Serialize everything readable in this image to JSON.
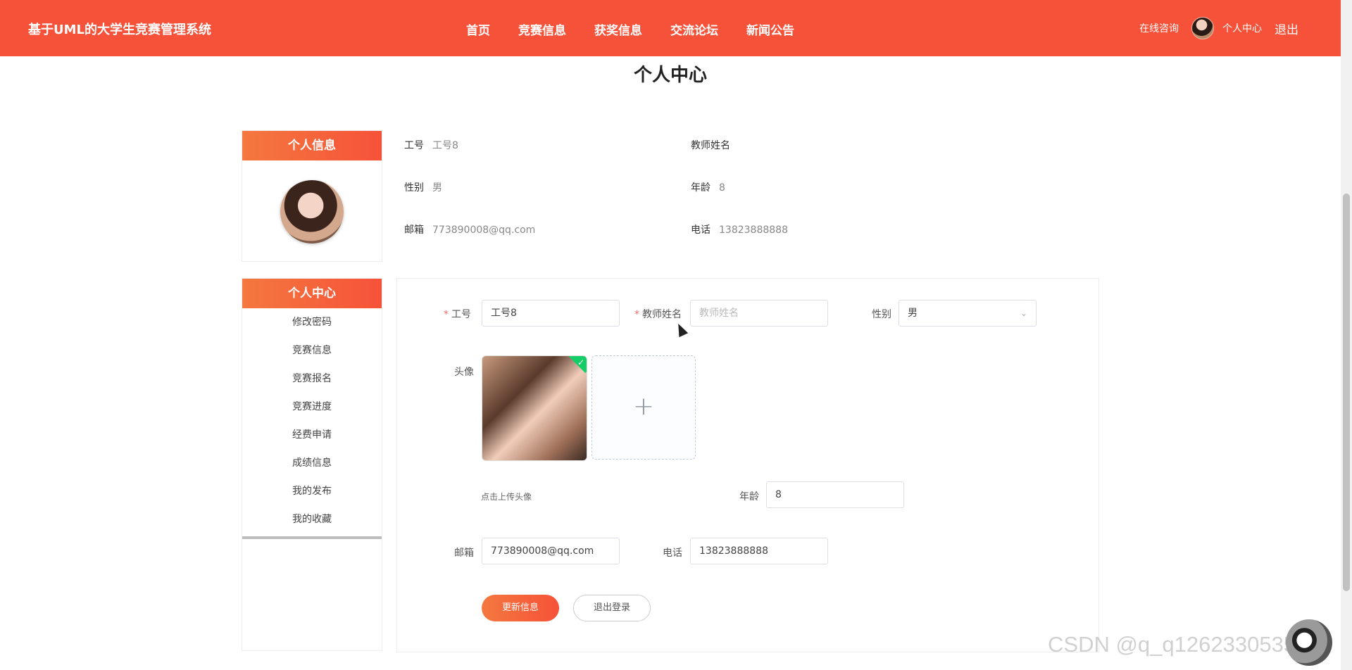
{
  "header": {
    "brand": "基于UML的大学生竞赛管理系统",
    "nav": [
      "首页",
      "竞赛信息",
      "获奖信息",
      "交流论坛",
      "新闻公告"
    ],
    "consult": "在线咨询",
    "center": "个人中心",
    "logout": "退出"
  },
  "page": {
    "title": "个人中心"
  },
  "sidebar": {
    "profile_heading": "个人信息",
    "menu_heading": "个人中心",
    "menu": [
      "修改密码",
      "竞赛信息",
      "竞赛报名",
      "竞赛进度",
      "经费申请",
      "成绩信息",
      "我的发布",
      "我的收藏"
    ]
  },
  "info": {
    "gonghao_label": "工号",
    "gonghao": "工号8",
    "jiaoshi_label": "教师姓名",
    "xingbie_label": "性别",
    "xingbie": "男",
    "nianling_label": "年龄",
    "nianling": "8",
    "youxiang_label": "邮箱",
    "youxiang": "773890008@qq.com",
    "dianhua_label": "电话",
    "dianhua": "13823888888"
  },
  "form": {
    "gonghao_label": "工号",
    "gonghao": "工号8",
    "jiaoshi_label": "教师姓名",
    "jiaoshi_placeholder": "教师姓名",
    "xingbie_label": "性别",
    "xingbie": "男",
    "touxiang_label": "头像",
    "upload_hint": "点击上传头像",
    "nianling_label": "年龄",
    "nianling": "8",
    "youxiang_label": "邮箱",
    "youxiang": "773890008@qq.com",
    "dianhua_label": "电话",
    "dianhua": "13823888888",
    "submit": "更新信息",
    "logout": "退出登录"
  },
  "watermark": "CSDN @q_q1262330535"
}
